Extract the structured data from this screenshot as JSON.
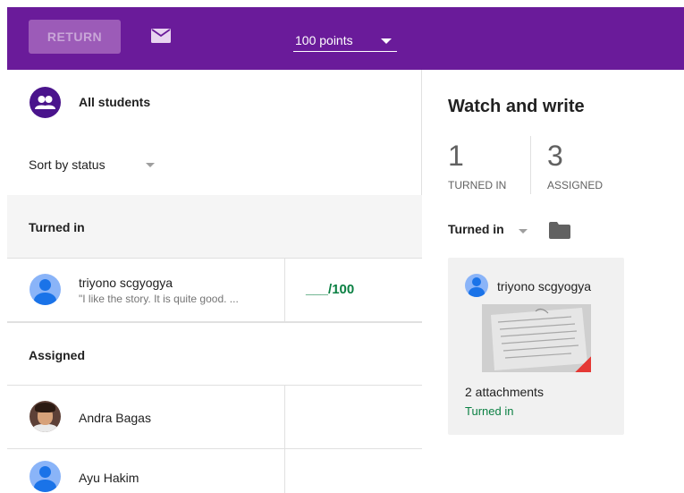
{
  "toolbar": {
    "return_label": "RETURN",
    "mail_icon": "mail-icon",
    "points_value": "100 points",
    "bar_color": "#6a1b9a"
  },
  "left_panel": {
    "all_students_label": "All students",
    "sort_label": "Sort by status",
    "sections": [
      {
        "header": "Turned in",
        "rows": [
          {
            "name": "triyono scgyogya",
            "comment": "\"I like the story. It is quite good. ...",
            "grade": "___/100"
          }
        ]
      },
      {
        "header": "Assigned",
        "rows": [
          {
            "name": "Andra Bagas"
          },
          {
            "name": "Ayu Hakim"
          }
        ]
      }
    ]
  },
  "right_panel": {
    "title": "Watch and write",
    "stats": [
      {
        "value": "1",
        "label": "TURNED IN"
      },
      {
        "value": "3",
        "label": "ASSIGNED"
      }
    ],
    "filter_label": "Turned in",
    "folder_icon": "folder-icon",
    "card": {
      "student_name": "triyono scgyogya",
      "attachments": "2 attachments",
      "status": "Turned in",
      "status_color": "#0b8043"
    }
  }
}
